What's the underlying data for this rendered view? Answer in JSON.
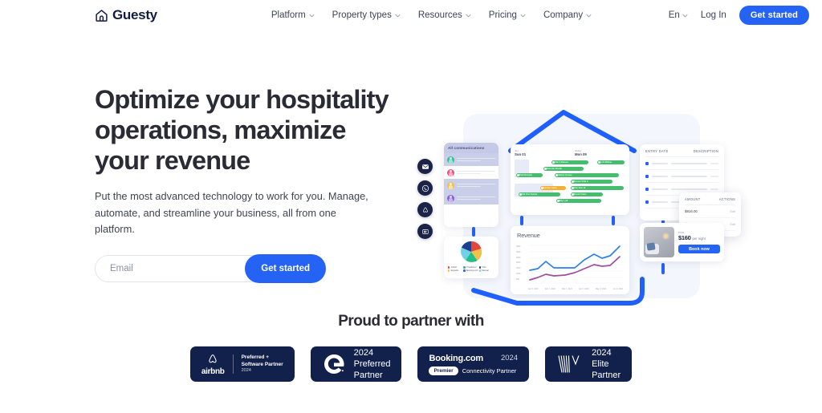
{
  "brand": {
    "name": "Guesty",
    "accent": "#2563f5",
    "dark": "#12214c"
  },
  "header": {
    "nav": [
      {
        "label": "Platform",
        "icon": "chevron-down-icon"
      },
      {
        "label": "Property types",
        "icon": "chevron-down-icon"
      },
      {
        "label": "Resources",
        "icon": "chevron-down-icon"
      },
      {
        "label": "Pricing",
        "icon": "chevron-down-icon"
      },
      {
        "label": "Company",
        "icon": "chevron-down-icon"
      }
    ],
    "language": "En",
    "login": "Log In",
    "cta": "Get started"
  },
  "hero": {
    "headline_line1": "Optimize your hospitality",
    "headline_line2": "operations, maximize",
    "headline_line3": "your revenue",
    "subcopy": "Put the most advanced technology to work for you. Manage, automate, and streamline your business, all from one platform.",
    "email_placeholder": "Email",
    "email_value": "",
    "form_cta": "Get started"
  },
  "illustration": {
    "rail_icons": [
      "email-icon",
      "whatsapp-icon",
      "airbnb-icon",
      "booking-icon"
    ],
    "communications": {
      "title": "All communications",
      "rows": [
        {
          "avatar_color": "#35c29a"
        },
        {
          "avatar_color": "#e8557f"
        },
        {
          "avatar_color": "#f2c14a"
        },
        {
          "avatar_color": "#8a63d2"
        }
      ]
    },
    "channel_pie": {
      "legend": [
        {
          "label": "Airbnb",
          "color": "#e8443a"
        },
        {
          "label": "Tripadvisor",
          "color": "#21c08b"
        },
        {
          "label": "Vrbo",
          "color": "#1d3f8f"
        },
        {
          "label": "Expedia",
          "color": "#f2c14a"
        },
        {
          "label": "Booking.com",
          "color": "#2563f5"
        },
        {
          "label": "Manual",
          "color": "#6fd1e8"
        }
      ]
    },
    "calendar": {
      "left_month": "Jun",
      "left_day": "Sun 01",
      "right_label": "Today",
      "right_day": "Mon 09",
      "bars": [
        {
          "label": "Unit 3 Deluxe"
        },
        {
          "label": "Loft Milano"
        },
        {
          "label": "Seaside Studio"
        },
        {
          "label": "Park Retreat"
        },
        {
          "label": "Harbor House"
        },
        {
          "label": "Sunset Villa A"
        },
        {
          "label": "Garden Suite"
        },
        {
          "label": "City Flat 12"
        },
        {
          "label": "Old Port Estate"
        },
        {
          "label": "Bondi Views"
        },
        {
          "label": "Sky Loft"
        }
      ]
    },
    "revenue_chart": {
      "title": "Revenue",
      "y_ticks": [
        "3500",
        "3000",
        "2500",
        "2000",
        "1500",
        "1000",
        "500"
      ],
      "x_ticks": [
        "Jan 3, 2024",
        "Feb 3, 2024",
        "Mar 3, 2024",
        "Apr 3, 2024",
        "May 3, 2024",
        "Jun 3, 2024"
      ]
    },
    "entry_table": {
      "col_entry_date": "ENTRY DATE",
      "col_description": "DESCRIPTION"
    },
    "amount_panel": {
      "col_amount": "AMOUNT",
      "col_actions": "ACTIONS",
      "rows": [
        {
          "amount": "$816.00",
          "action": "Edit"
        },
        {
          "amount": "$825.12",
          "action": "Edit"
        }
      ]
    },
    "booking_card": {
      "from": "from",
      "price": "$160",
      "per": "per night",
      "button": "Book now"
    }
  },
  "partners": {
    "title": "Proud to partner with",
    "badges": [
      {
        "id": "airbnb",
        "logo_name": "airbnb-logo",
        "brand": "airbnb",
        "line1": "Preferred +",
        "line2": "Software Partner",
        "line3": "2024"
      },
      {
        "id": "expedia",
        "logo_name": "expedia-logo",
        "line1": "2024",
        "line2": "Preferred",
        "line3": "Partner"
      },
      {
        "id": "booking",
        "logo_name": "booking-logo",
        "brand": "Booking.com",
        "year": "2024",
        "pill": "Premier",
        "sub": "Connectivity Partner"
      },
      {
        "id": "vrbo",
        "logo_name": "vrbo-logo",
        "line1": "2024",
        "line2": "Elite",
        "line3": "Partner"
      }
    ]
  }
}
